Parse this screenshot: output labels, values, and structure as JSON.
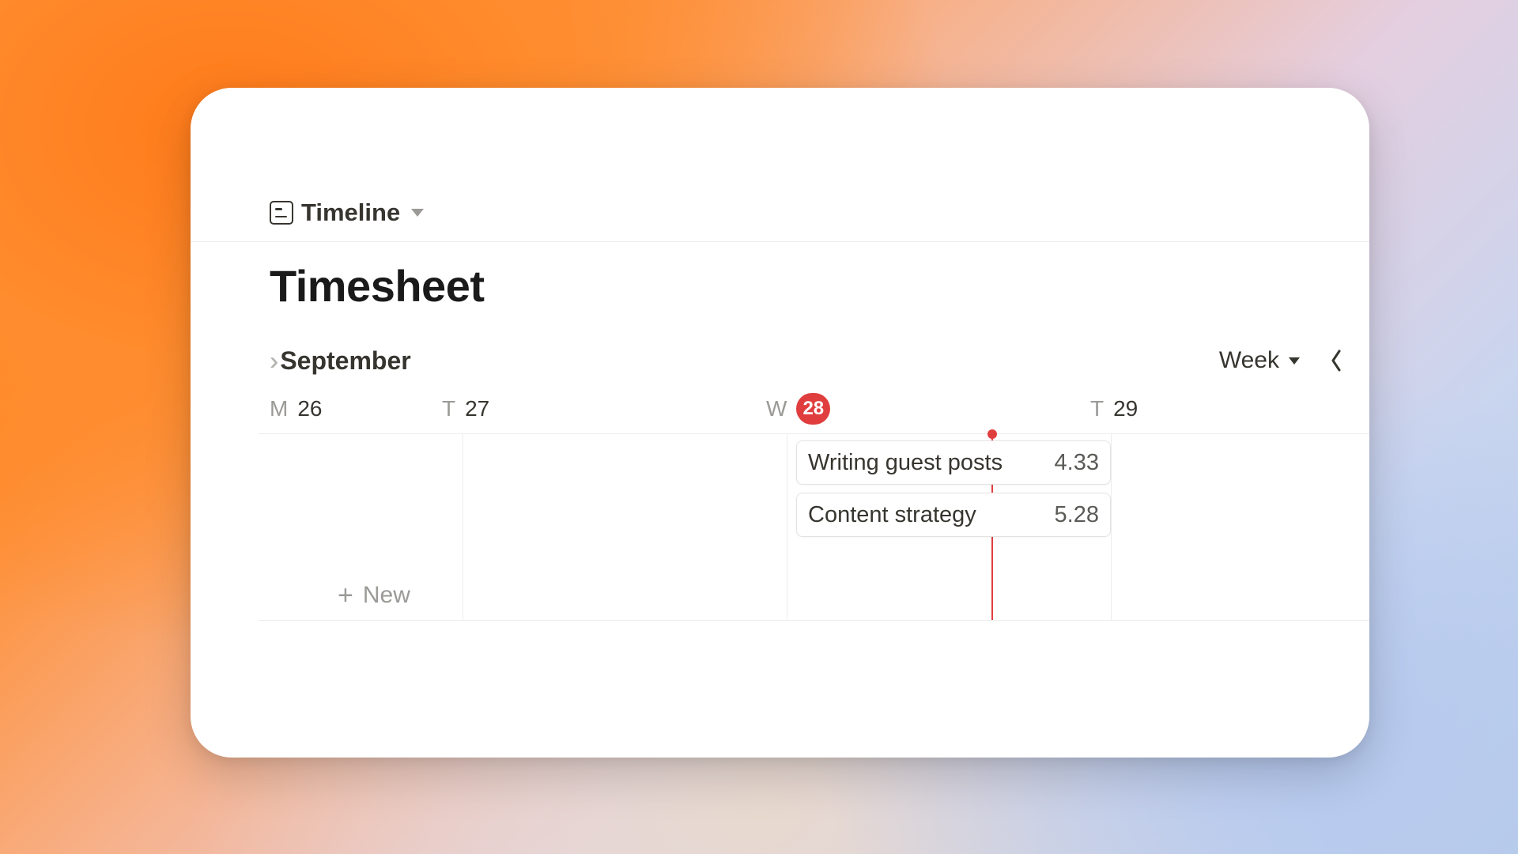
{
  "view": {
    "name": "Timeline"
  },
  "page": {
    "title": "Timesheet"
  },
  "timeline": {
    "month": "September",
    "range_selector": "Week",
    "days": [
      {
        "dow": "M",
        "num": "26",
        "today": false
      },
      {
        "dow": "T",
        "num": "27",
        "today": false
      },
      {
        "dow": "W",
        "num": "28",
        "today": true
      },
      {
        "dow": "T",
        "num": "29",
        "today": false
      }
    ],
    "entries": [
      {
        "title": "Writing guest posts",
        "value": "4.33"
      },
      {
        "title": "Content strategy",
        "value": "5.28"
      }
    ],
    "new_label": "New"
  }
}
